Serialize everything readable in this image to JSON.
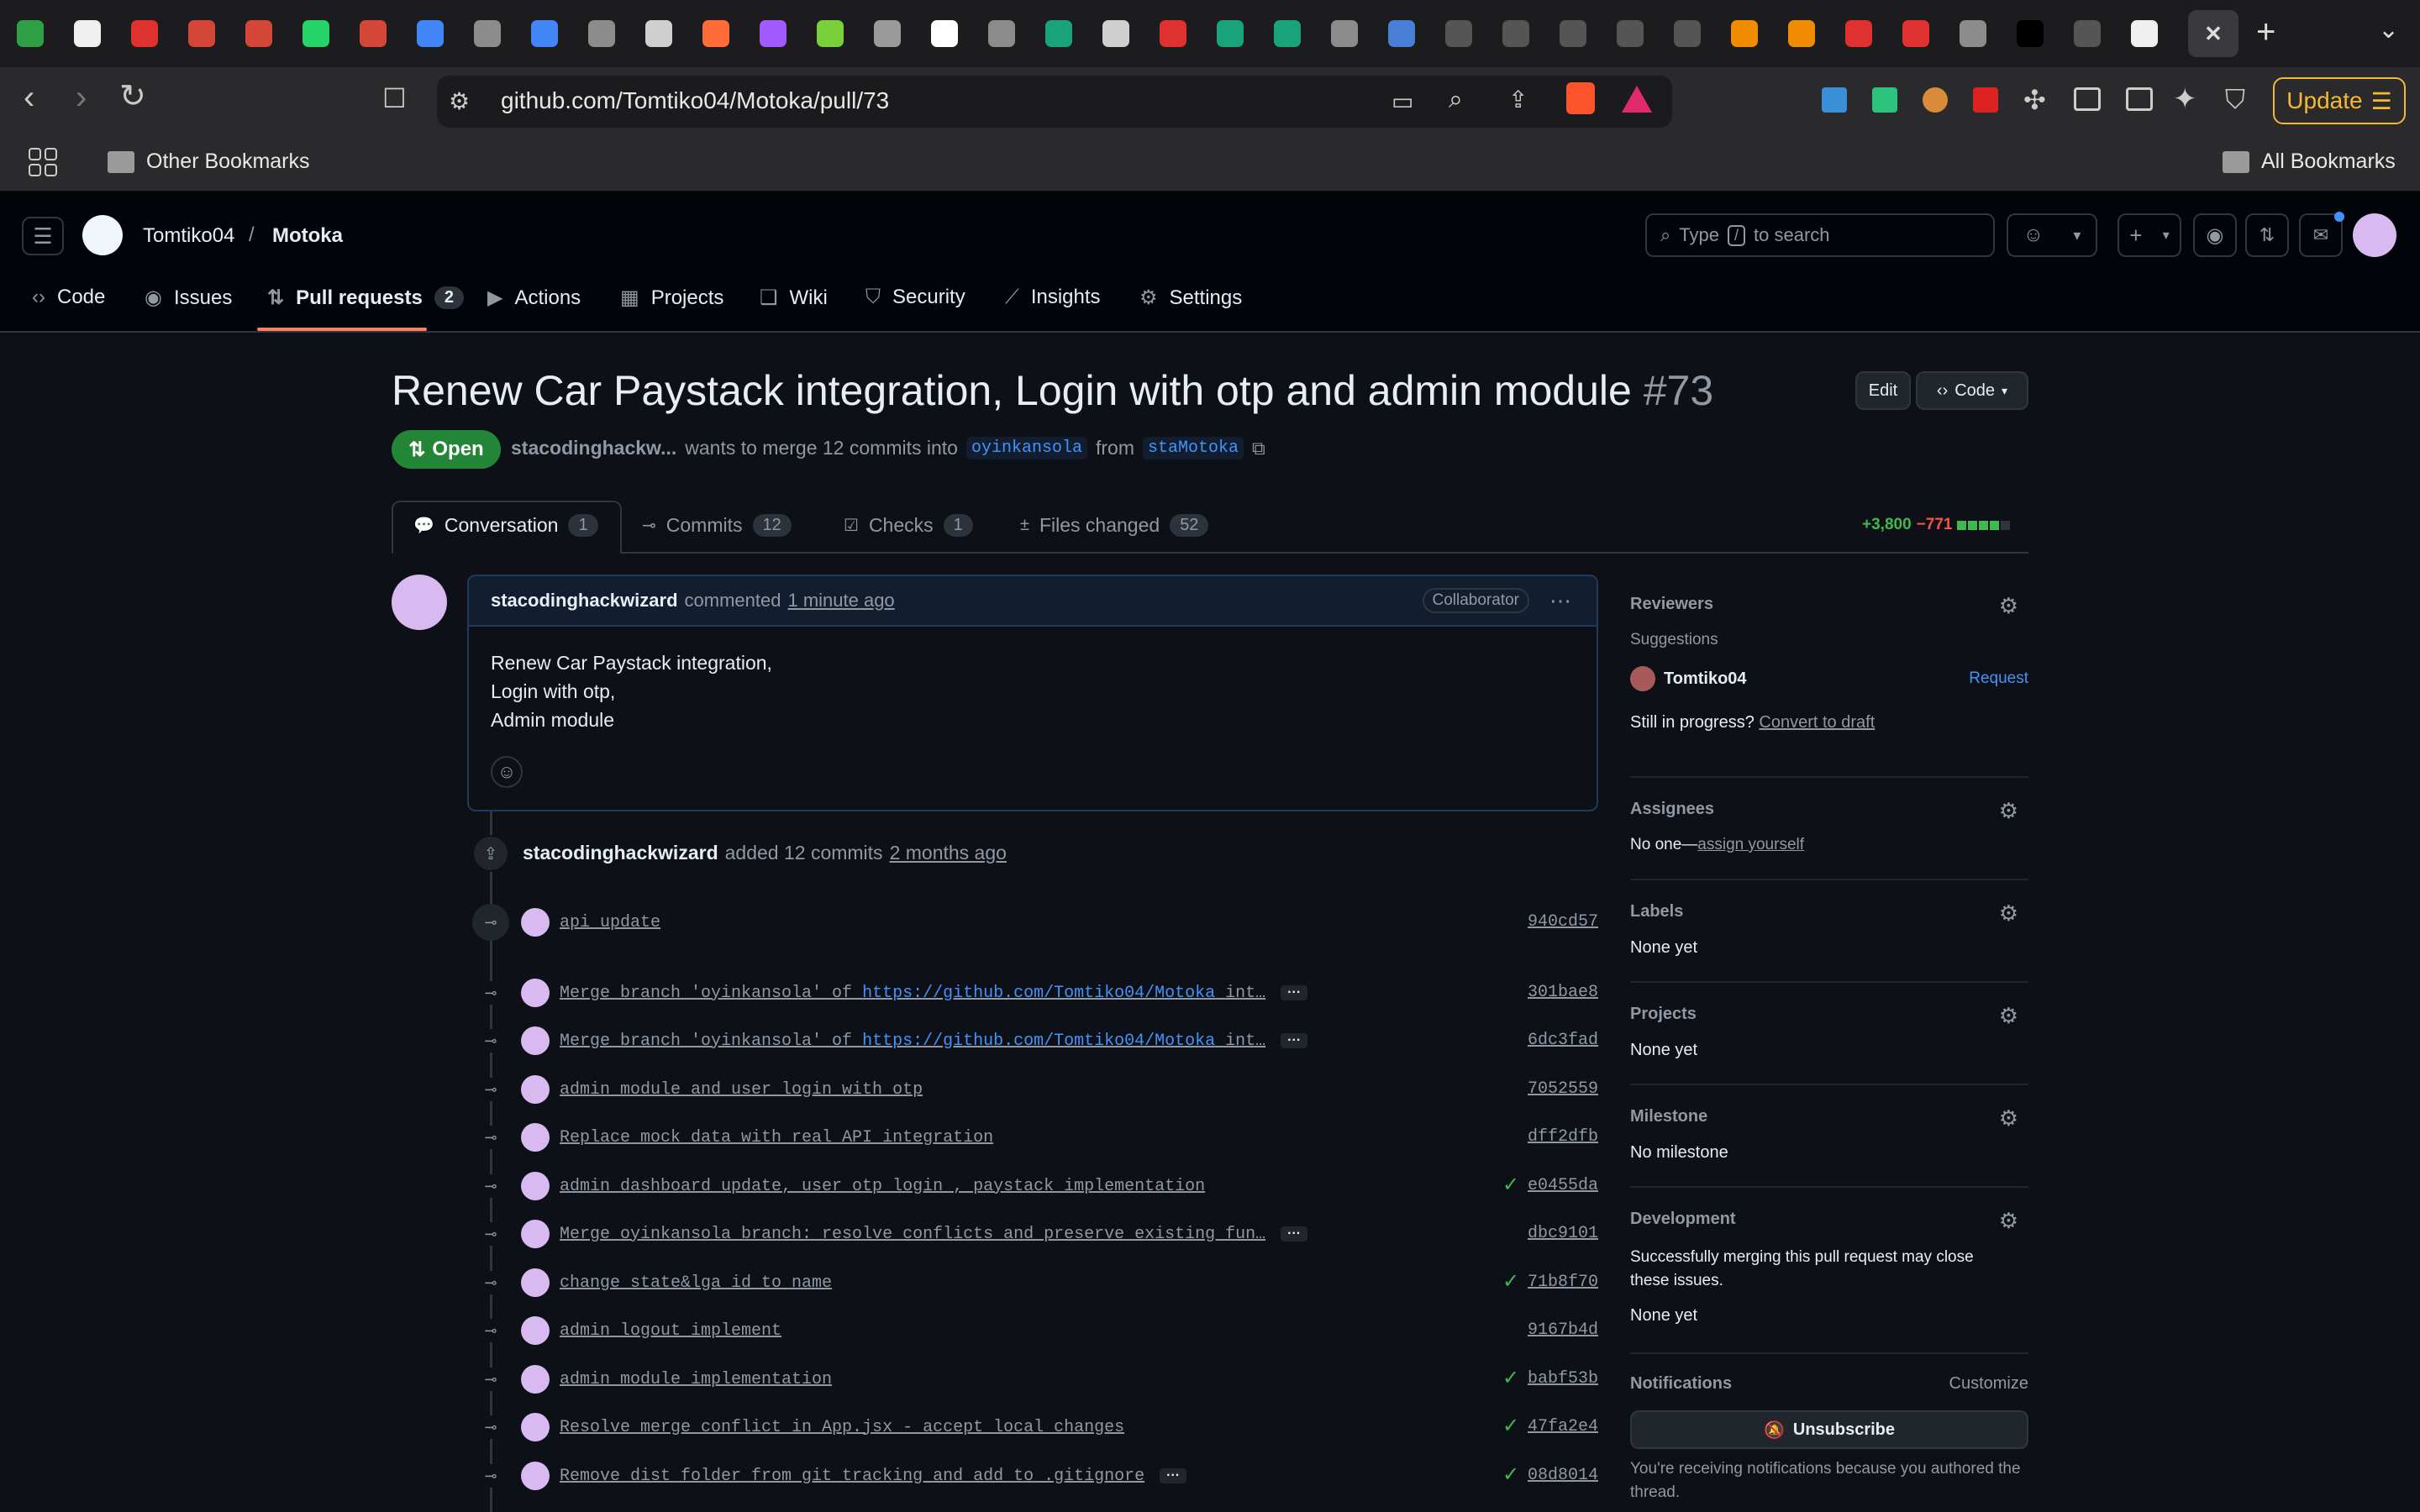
{
  "browser": {
    "url": "github.com/Tomtiko04/Motoka/pull/73",
    "update_label": "Update",
    "bookmarks": {
      "other": "Other Bookmarks",
      "all": "All Bookmarks"
    },
    "tabs": [
      "meet-icon",
      "github-icon",
      "youtube-music-icon",
      "gmail-icon",
      "gmail-icon",
      "whatsapp-icon",
      "gmail-icon",
      "docs-icon",
      "globe-icon",
      "docs-icon",
      "globe-icon",
      "chatgpt-icon",
      "postman-icon",
      "figma-icon",
      "package-icon",
      "trello-icon",
      "vercel-icon",
      "globe-icon",
      "globe-icon",
      "notion-icon",
      "app-icon",
      "bird-icon",
      "bird-icon",
      "globe-icon",
      "printer-icon",
      "h-icon",
      "h-icon",
      "h-icon",
      "h-icon",
      "h-icon",
      "app-icon",
      "app-icon",
      "app-icon",
      "app-icon",
      "globe-icon",
      "black-icon",
      "h-icon",
      "github-icon",
      "close-icon"
    ]
  },
  "header": {
    "owner": "Tomtiko04",
    "separator": "/",
    "repo": "Motoka",
    "search_placeholder_pre": "Type",
    "search_key": "/",
    "search_placeholder_post": "to search"
  },
  "repo_nav": [
    {
      "label": "Code",
      "icon": "code-icon"
    },
    {
      "label": "Issues",
      "icon": "issue-icon"
    },
    {
      "label": "Pull requests",
      "icon": "pr-icon",
      "count": "2"
    },
    {
      "label": "Actions",
      "icon": "play-icon"
    },
    {
      "label": "Projects",
      "icon": "table-icon"
    },
    {
      "label": "Wiki",
      "icon": "book-icon"
    },
    {
      "label": "Security",
      "icon": "shield-icon"
    },
    {
      "label": "Insights",
      "icon": "graph-icon"
    },
    {
      "label": "Settings",
      "icon": "gear-icon"
    }
  ],
  "pr": {
    "title": "Renew Car Paystack integration, Login with otp and admin module",
    "number": "#73",
    "state": "Open",
    "author_short": "stacodinghackw...",
    "merge_text": "wants to merge 12 commits into",
    "base": "oyinkansola",
    "from_text": "from",
    "head": "staMotoka",
    "edit_label": "Edit",
    "code_label": "Code",
    "tabs": [
      {
        "label": "Conversation",
        "count": "1"
      },
      {
        "label": "Commits",
        "count": "12"
      },
      {
        "label": "Checks",
        "count": "1"
      },
      {
        "label": "Files changed",
        "count": "52"
      }
    ],
    "additions": "+3,800",
    "deletions": "−771"
  },
  "comment": {
    "author": "stacodinghackwizard",
    "action": "commented",
    "time": "1 minute ago",
    "badge": "Collaborator",
    "lines": [
      "Renew Car Paystack integration,",
      "Login with otp,",
      "Admin module"
    ]
  },
  "event": {
    "actor": "stacodinghackwizard",
    "text": "added 12 commits",
    "time": "2 months ago"
  },
  "commits": [
    {
      "msg": "api update",
      "sha": "940cd57",
      "check": false,
      "more": false
    },
    {
      "msg_pre": "Merge branch 'oyinkansola' of ",
      "link": "https://github.com/Tomtiko04/Motoka",
      "msg_post": " int…",
      "sha": "301bae8",
      "check": false,
      "more": true
    },
    {
      "msg_pre": "Merge branch 'oyinkansola' of ",
      "link": "https://github.com/Tomtiko04/Motoka",
      "msg_post": " int…",
      "sha": "6dc3fad",
      "check": false,
      "more": true
    },
    {
      "msg": "admin module and user login with otp",
      "sha": "7052559",
      "check": false,
      "more": false
    },
    {
      "msg": "Replace mock data with real API integration",
      "sha": "dff2dfb",
      "check": false,
      "more": false
    },
    {
      "msg": "admin dashboard update, user otp login , paystack implementation",
      "sha": "e0455da",
      "check": true,
      "more": false
    },
    {
      "msg": "Merge oyinkansola branch: resolve conflicts and preserve existing fun…",
      "sha": "dbc9101",
      "check": false,
      "more": true
    },
    {
      "msg": "change state&lga id to name",
      "sha": "71b8f70",
      "check": true,
      "more": false
    },
    {
      "msg": "admin logout implement",
      "sha": "9167b4d",
      "check": false,
      "more": false
    },
    {
      "msg": "admin module implementation",
      "sha": "babf53b",
      "check": true,
      "more": false
    },
    {
      "msg": "Resolve merge conflict in App.jsx - accept local changes",
      "sha": "47fa2e4",
      "check": true,
      "more": false
    },
    {
      "msg": "Remove dist folder from git tracking and add to .gitignore",
      "sha": "08d8014",
      "check": true,
      "more": true
    }
  ],
  "sidebar": {
    "reviewers": {
      "title": "Reviewers",
      "suggestions": "Suggestions",
      "user": "Tomtiko04",
      "request": "Request",
      "still": "Still in progress?",
      "draft": "Convert to draft"
    },
    "assignees": {
      "title": "Assignees",
      "none": "No one—",
      "assign": "assign yourself"
    },
    "labels": {
      "title": "Labels",
      "value": "None yet"
    },
    "projects": {
      "title": "Projects",
      "value": "None yet"
    },
    "milestone": {
      "title": "Milestone",
      "value": "No milestone"
    },
    "development": {
      "title": "Development",
      "desc": "Successfully merging this pull request may close these issues.",
      "value": "None yet"
    },
    "notifications": {
      "title": "Notifications",
      "customize": "Customize",
      "button": "Unsubscribe",
      "note": "You're receiving notifications because you authored the thread."
    }
  }
}
